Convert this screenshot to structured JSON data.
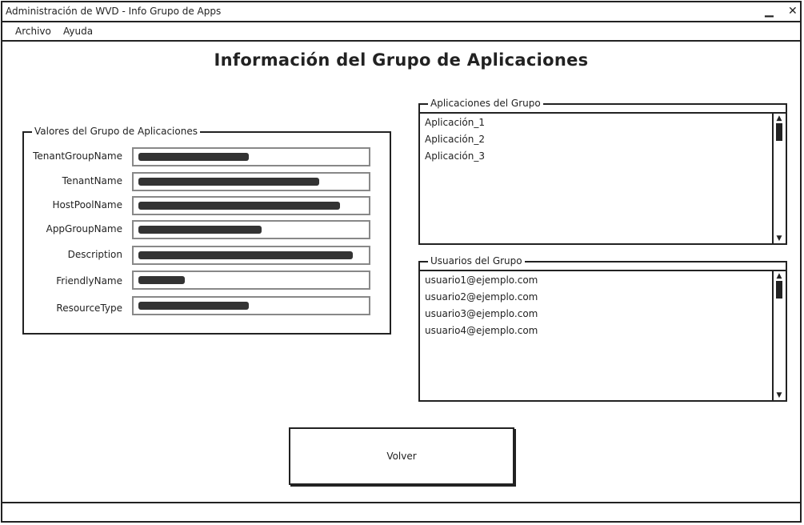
{
  "window": {
    "title": "Administración de WVD - Info Grupo de Apps",
    "minimize": "▁",
    "close": "✕"
  },
  "menu": {
    "items": [
      "Archivo",
      "Ayuda"
    ]
  },
  "page_title": "Información del Grupo de Aplicaciones",
  "values_panel": {
    "legend": "Valores del Grupo de Aplicaciones",
    "rows": [
      {
        "label": "TenantGroupName"
      },
      {
        "label": "TenantName"
      },
      {
        "label": "HostPoolName"
      },
      {
        "label": "AppGroupName"
      },
      {
        "label": "Description"
      },
      {
        "label": "FriendlyName"
      },
      {
        "label": "ResourceType"
      }
    ]
  },
  "apps_panel": {
    "legend": "Aplicaciones del Grupo",
    "items": [
      "Aplicación_1",
      "Aplicación_2",
      "Aplicación_3"
    ]
  },
  "users_panel": {
    "legend": "Usuarios del Grupo",
    "items": [
      "usuario1@ejemplo.com",
      "usuario2@ejemplo.com",
      "usuario3@ejemplo.com",
      "usuario4@ejemplo.com"
    ]
  },
  "back_button": "Volver"
}
